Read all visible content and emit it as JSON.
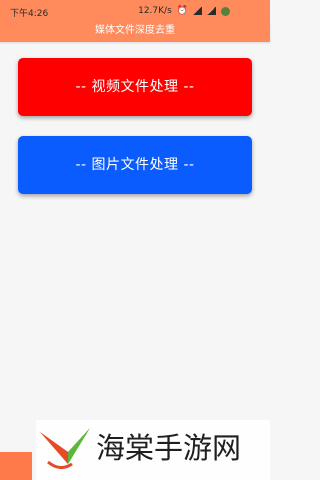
{
  "status_bar": {
    "time": "下午4:26",
    "speed": "12.7K/s",
    "icons": [
      "alarm-icon",
      "wifi-icon",
      "signal-icon",
      "battery-icon"
    ]
  },
  "app_bar": {
    "title": "媒体文件深度去重",
    "color": "#ff8a5c"
  },
  "buttons": {
    "video": {
      "label": "-- 视频文件处理 --",
      "color": "#ff0000"
    },
    "image": {
      "label": "-- 图片文件处理 --",
      "color": "#0a5cff"
    }
  },
  "watermark": {
    "text": "海棠手游网",
    "icon": "leaf-logo-icon"
  }
}
